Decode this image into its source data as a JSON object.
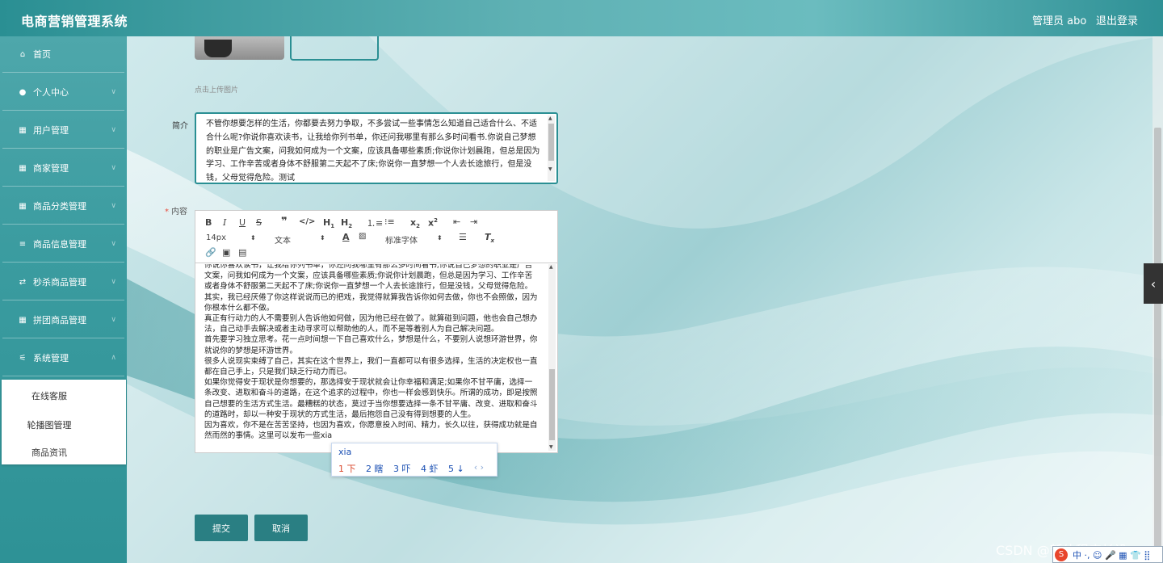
{
  "header": {
    "brand": "电商营销管理系统",
    "user": "管理员 abo",
    "logout": "退出登录"
  },
  "sidebar": {
    "items": [
      {
        "label": "首页",
        "icon": "home-icon"
      },
      {
        "label": "个人中心",
        "icon": "user-icon"
      },
      {
        "label": "用户管理",
        "icon": "grid-icon"
      },
      {
        "label": "商家管理",
        "icon": "grid-icon"
      },
      {
        "label": "商品分类管理",
        "icon": "grid-icon"
      },
      {
        "label": "商品信息管理",
        "icon": "list-icon"
      },
      {
        "label": "秒杀商品管理",
        "icon": "shuffle-icon"
      },
      {
        "label": "拼团商品管理",
        "icon": "grid-icon"
      },
      {
        "label": "系统管理",
        "icon": "sliders-icon"
      }
    ],
    "submenu": [
      "在线客服",
      "轮播图管理",
      "商品资讯"
    ]
  },
  "form": {
    "upload_hint": "点击上传图片",
    "intro_label": "简介",
    "intro_text": "不管你想要怎样的生活，你都要去努力争取，不多尝试一些事情怎么知道自己适合什么、不适合什么呢?你说你喜欢读书，让我给你列书单，你还问我哪里有那么多时间看书.你说自己梦想的职业是广告文案，问我如何成为一个文案，应该具备哪些素质;你说你计划晨跑，但总是因为学习、工作辛苦或者身体不舒服第二天起不了床;你说你一直梦想一个人去长途旅行，但是没钱，父母觉得危险。测试",
    "content_label": "内容",
    "toolbar": {
      "font_size": "14px",
      "block_type": "文本",
      "font_family": "标准字体"
    },
    "content_paragraphs": [
      "你说你喜欢读书，让我给你列书单，你还问我哪里有那么多时间看书;你说自己梦想的职业是广告文案，问我如何成为一个文案，应该具备哪些素质;你说你计划晨跑，但总是因为学习、工作辛苦或者身体不舒服第二天起不了床;你说你一直梦想一个人去长途旅行，但是没钱，父母觉得危险。其实，我已经厌倦了你这样说说而已的把戏，我觉得就算我告诉你如何去做，你也不会照做，因为你根本什么都不做。",
      "真正有行动力的人不需要别人告诉他如何做，因为他已经在做了。就算碰到问题，他也会自己想办法，自己动手去解决或者主动寻求可以帮助他的人，而不是等着别人为自己解决问题。",
      "首先要学习独立思考。花一点时间想一下自己喜欢什么，梦想是什么，不要别人说想环游世界，你就说你的梦想是环游世界。",
      "很多人说现实束缚了自己，其实在这个世界上，我们一直都可以有很多选择，生活的决定权也一直都在自己手上，只是我们缺乏行动力而已。",
      "如果你觉得安于现状是你想要的，那选择安于现状就会让你幸福和满足;如果你不甘平庸，选择一条改变、进取和奋斗的道路，在这个追求的过程中，你也一样会感到快乐。所谓的成功，即是按照自己想要的生活方式生活。最糟糕的状态，莫过于当你想要选择一条不甘平庸、改变、进取和奋斗的道路时，却以一种安于现状的方式生活，最后抱怨自己没有得到想要的人生。",
      "因为喜欢，你不是在苦苦坚持，也因为喜欢，你愿意投入时间、精力，长久以往，获得成功就是自然而然的事情。这里可以发布一些xia"
    ],
    "ime": {
      "composition": "xia",
      "candidates": [
        "1 下",
        "2 瞎",
        "3 吓",
        "4 虾",
        "5 ↓"
      ]
    },
    "submit": "提交",
    "cancel": "取消"
  },
  "watermark": "CSDN @新体程序长设",
  "ime_bar": "中 ·, ☺ 🎤 ▦ 👕 ⣿"
}
